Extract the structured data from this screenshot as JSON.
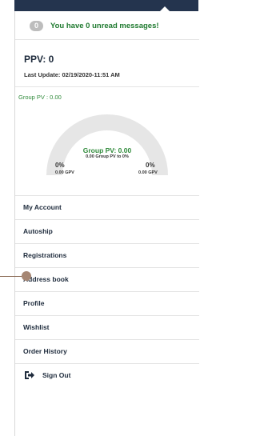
{
  "messages": {
    "count": "0",
    "text": "You have 0 unread messages!"
  },
  "ppv": {
    "title": "PPV: 0",
    "last_update": "Last Update: 02/19/2020-11:51 AM"
  },
  "group_pv": {
    "label": "Group PV : 0.00",
    "gauge_center": "Group PV: 0.00",
    "gauge_sub": "0.00 Group PV to 0%",
    "left_pct": "0%",
    "left_gpv": "0.00 GPV",
    "right_pct": "0%",
    "right_gpv": "0.00 GPV",
    "progress": 0
  },
  "menu": {
    "items": [
      {
        "label": "My Account"
      },
      {
        "label": "Autoship"
      },
      {
        "label": "Registrations"
      },
      {
        "label": "Address book"
      },
      {
        "label": "Profile"
      },
      {
        "label": "Wishlist"
      },
      {
        "label": "Order History"
      }
    ],
    "signout": {
      "label": "Sign Out",
      "icon": "sign-out-icon"
    }
  },
  "colors": {
    "topbar": "#24344e",
    "message_text": "#1f7a2f",
    "gauge_track": "#e6e6e6",
    "accent_green": "#2f8a3a",
    "pointer": "#a68673"
  }
}
